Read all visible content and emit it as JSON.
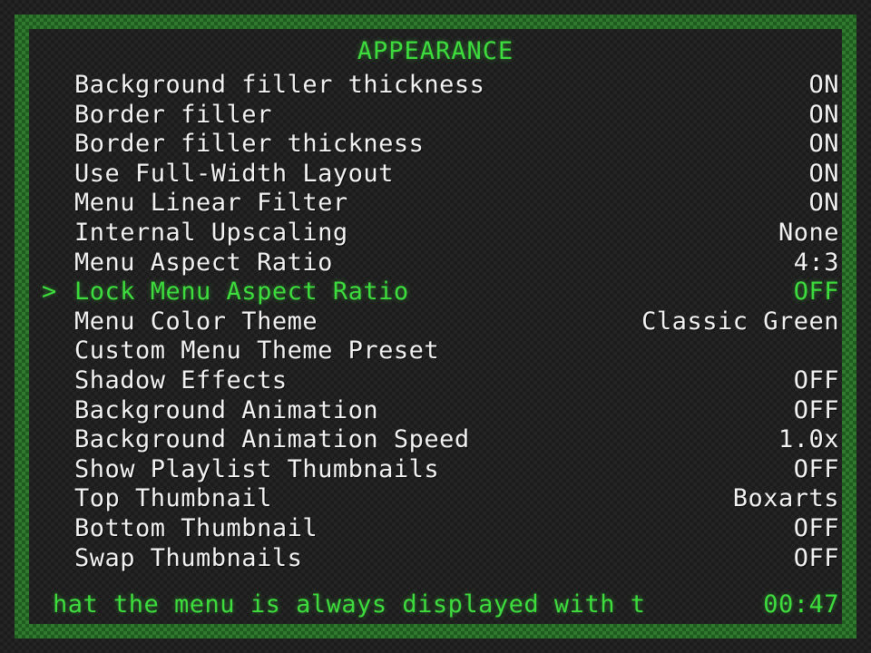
{
  "menu": {
    "title": "APPEARANCE",
    "cursor_glyph": ">",
    "selected_index": 7,
    "entries": [
      {
        "label": "Background filler thickness",
        "value": "ON"
      },
      {
        "label": "Border filler",
        "value": "ON"
      },
      {
        "label": "Border filler thickness",
        "value": "ON"
      },
      {
        "label": "Use Full-Width Layout",
        "value": "ON"
      },
      {
        "label": "Menu Linear Filter",
        "value": "ON"
      },
      {
        "label": "Internal Upscaling",
        "value": "None"
      },
      {
        "label": "Menu Aspect Ratio",
        "value": "4:3"
      },
      {
        "label": "Lock Menu Aspect Ratio",
        "value": "OFF"
      },
      {
        "label": "Menu Color Theme",
        "value": "Classic Green"
      },
      {
        "label": "Custom Menu Theme Preset",
        "value": ""
      },
      {
        "label": "Shadow Effects",
        "value": "OFF"
      },
      {
        "label": "Background Animation",
        "value": "OFF"
      },
      {
        "label": "Background Animation Speed",
        "value": "1.0x"
      },
      {
        "label": "Show Playlist Thumbnails",
        "value": "OFF"
      },
      {
        "label": "Top Thumbnail",
        "value": "Boxarts"
      },
      {
        "label": "Bottom Thumbnail",
        "value": "OFF"
      },
      {
        "label": "Swap Thumbnails",
        "value": "OFF"
      }
    ]
  },
  "status_bar": {
    "message": "hat the menu is always displayed with t",
    "clock": "00:47"
  },
  "theme": {
    "accent_green": "#3ddd3d",
    "border_green": "#2f7a2f",
    "text_white": "#f2f2f2",
    "background_dark": "#242424"
  }
}
